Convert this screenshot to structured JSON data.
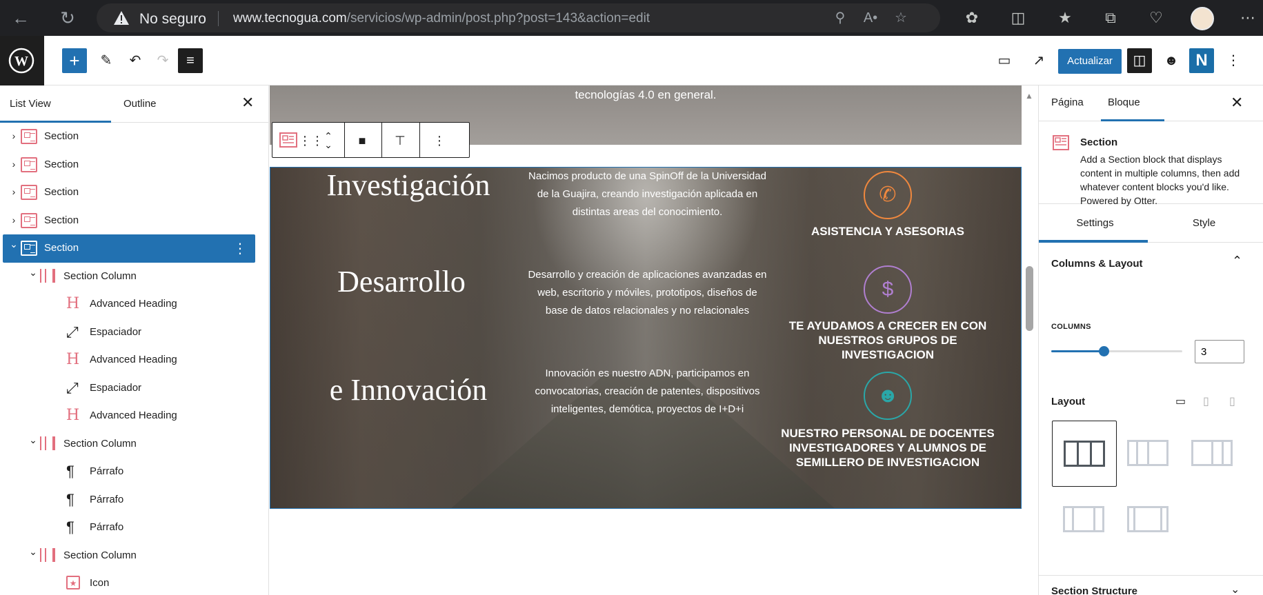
{
  "browser": {
    "security_label": "No seguro",
    "url_host": "www.tecnogua.com",
    "url_path": "/servicios/wp-admin/post.php?post=143&action=edit"
  },
  "toolbar": {
    "update_label": "Actualizar"
  },
  "left_panel": {
    "tab_list_view": "List View",
    "tab_outline": "Outline",
    "items": [
      {
        "label": "Section",
        "depth": 0,
        "caret": "right",
        "icon": "section"
      },
      {
        "label": "Section",
        "depth": 0,
        "caret": "right",
        "icon": "section"
      },
      {
        "label": "Section",
        "depth": 0,
        "caret": "right",
        "icon": "section"
      },
      {
        "label": "Section",
        "depth": 0,
        "caret": "right",
        "icon": "section"
      },
      {
        "label": "Section",
        "depth": 0,
        "caret": "down",
        "icon": "section",
        "selected": true
      },
      {
        "label": "Section Column",
        "depth": 1,
        "caret": "down",
        "icon": "column"
      },
      {
        "label": "Advanced Heading",
        "depth": 2,
        "icon": "heading"
      },
      {
        "label": "Espaciador",
        "depth": 2,
        "icon": "spacer"
      },
      {
        "label": "Advanced Heading",
        "depth": 2,
        "icon": "heading"
      },
      {
        "label": "Espaciador",
        "depth": 2,
        "icon": "spacer"
      },
      {
        "label": "Advanced Heading",
        "depth": 2,
        "icon": "heading"
      },
      {
        "label": "Section Column",
        "depth": 1,
        "caret": "down",
        "icon": "column"
      },
      {
        "label": "Párrafo",
        "depth": 2,
        "icon": "paragraph"
      },
      {
        "label": "Párrafo",
        "depth": 2,
        "icon": "paragraph"
      },
      {
        "label": "Párrafo",
        "depth": 2,
        "icon": "paragraph"
      },
      {
        "label": "Section Column",
        "depth": 1,
        "caret": "down",
        "icon": "column"
      },
      {
        "label": "Icon",
        "depth": 2,
        "icon": "icon"
      }
    ]
  },
  "canvas": {
    "prev_text": "tecnologías 4.0 en general.",
    "col1": {
      "word1": "Investigación",
      "word2": "Desarrollo",
      "word3": "e Innovación"
    },
    "col2": {
      "p1": "Nacimos producto de una SpinOff de la Universidad de la Guajira, creando investigación aplicada en distintas areas del conocimiento.",
      "p2": "Desarrollo y creación de aplicaciones avanzadas en web, escritorio y móviles, prototipos, diseños de base de datos relacionales y no relacionales",
      "p3": "Innovación es nuestro ADN, participamos en convocatorias, creación de patentes, dispositivos inteligentes, demótica, proyectos de I+D+i"
    },
    "col3": {
      "f1": "ASISTENCIA Y ASESORIAS",
      "f2": "TE AYUDAMOS A CRECER EN CON NUESTROS GRUPOS DE INVESTIGACION",
      "f3": "NUESTRO PERSONAL DE DOCENTES INVESTIGADORES Y ALUMNOS DE SEMILLERO DE INVESTIGACION",
      "icon_colors": [
        "#f0883e",
        "#b07fd0",
        "#2aa7a8"
      ]
    }
  },
  "right_panel": {
    "tab_page": "Página",
    "tab_block": "Bloque",
    "block_title": "Section",
    "block_desc": "Add a Section block that displays content in multiple columns, then add whatever content blocks you'd like. Powered by Otter.",
    "tab_settings": "Settings",
    "tab_style": "Style",
    "panel_title": "Columns & Layout",
    "columns_label": "COLUMNS",
    "columns_value": "3",
    "columns_slider_fraction": 0.4,
    "layout_label": "Layout",
    "footer_title": "Section Structure"
  }
}
